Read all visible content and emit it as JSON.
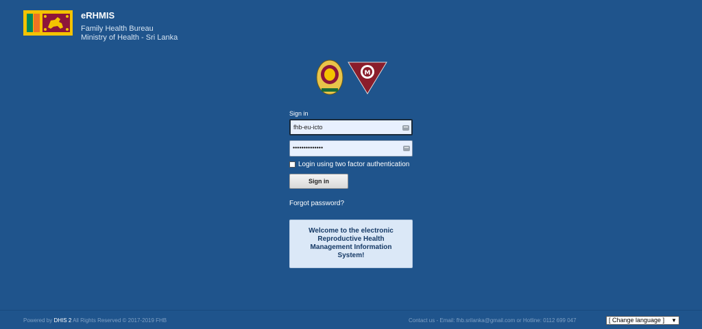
{
  "header": {
    "title": "eRHMIS",
    "line1": "Family Health Bureau",
    "line2": "Ministry of Health - Sri Lanka"
  },
  "login": {
    "section_label": "Sign in",
    "username_value": "fhb-eu-icto",
    "password_value": "••••••••••••••",
    "twofactor_label": "Login using two factor authentication",
    "signin_button": "Sign in",
    "forgot_link": "Forgot password?",
    "welcome_text": "Welcome to the electronic Reproductive Health Management Information System!"
  },
  "footer": {
    "powered_prefix": "Powered by",
    "powered_brand": "DHIS 2",
    "rights": "All Rights Reserved © 2017-2019 FHB",
    "contact": "Contact us - Email: fhb.srilanka@gmail.com or Hotline: 0112 699 047",
    "language_select": "[ Change language ]"
  },
  "colors": {
    "background": "#1f548c",
    "welcome_bg": "#dbe8f7"
  }
}
